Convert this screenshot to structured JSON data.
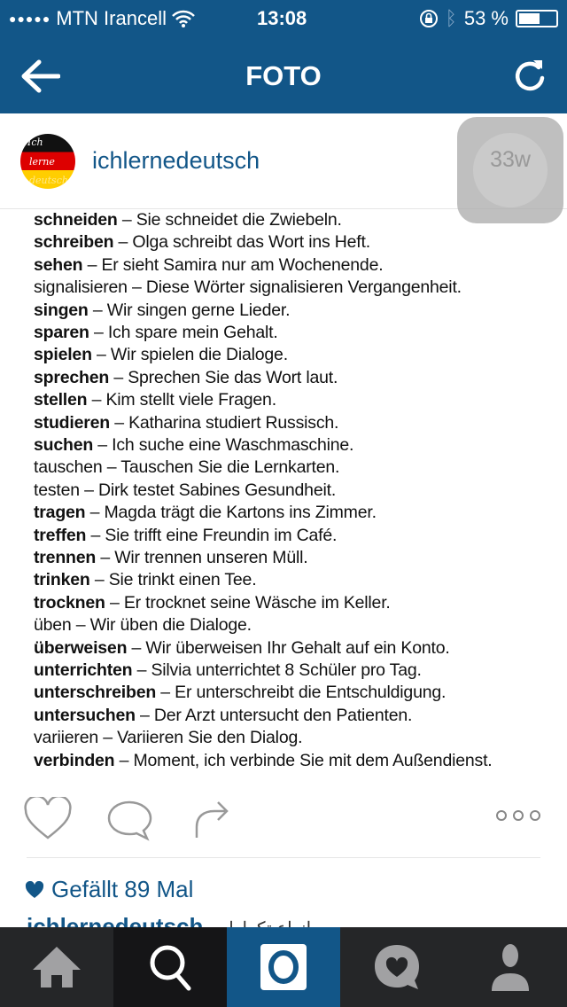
{
  "status": {
    "carrier": "MTN Irancell",
    "time": "13:08",
    "battery": "53 %",
    "battery_level": 53
  },
  "nav": {
    "title": "FOTO"
  },
  "post": {
    "username": "ichlernedeutsch",
    "avatar_text": [
      "Ich",
      "lerne",
      "deutsch"
    ],
    "timer": "33w",
    "photo_lines": [
      {
        "verb": "schneiden",
        "bold": true,
        "sentence": " – Sie schneidet die Zwiebeln."
      },
      {
        "verb": "schreiben",
        "bold": true,
        "sentence": " – Olga schreibt das Wort ins Heft."
      },
      {
        "verb": "sehen",
        "bold": true,
        "sentence": " – Er sieht Samira nur am Wochenende."
      },
      {
        "verb": "signalisieren",
        "bold": false,
        "sentence": " – Diese Wörter signalisieren Vergangenheit."
      },
      {
        "verb": "singen",
        "bold": true,
        "sentence": " – Wir singen gerne Lieder."
      },
      {
        "verb": "sparen",
        "bold": true,
        "sentence": " – Ich spare mein Gehalt."
      },
      {
        "verb": "spielen",
        "bold": true,
        "sentence": " – Wir spielen die Dialoge."
      },
      {
        "verb": "sprechen",
        "bold": true,
        "sentence": " – Sprechen Sie das Wort laut."
      },
      {
        "verb": "stellen",
        "bold": true,
        "sentence": " – Kim stellt viele Fragen."
      },
      {
        "verb": "studieren",
        "bold": true,
        "sentence": " – Katharina studiert Russisch."
      },
      {
        "verb": "suchen",
        "bold": true,
        "sentence": " – Ich suche eine Waschmaschine."
      },
      {
        "verb": "tauschen",
        "bold": false,
        "sentence": " – Tauschen Sie die Lernkarten."
      },
      {
        "verb": "testen",
        "bold": false,
        "sentence": " – Dirk testet Sabines Gesundheit."
      },
      {
        "verb": "tragen",
        "bold": true,
        "sentence": " – Magda trägt die Kartons ins Zimmer."
      },
      {
        "verb": "treffen",
        "bold": true,
        "sentence": " – Sie trifft eine Freundin im Café."
      },
      {
        "verb": "trennen",
        "bold": true,
        "sentence": " – Wir trennen unseren Müll."
      },
      {
        "verb": "trinken",
        "bold": true,
        "sentence": " – Sie trinkt einen Tee."
      },
      {
        "verb": "trocknen",
        "bold": true,
        "sentence": " – Er trocknet seine Wäsche im Keller."
      },
      {
        "verb": "üben",
        "bold": false,
        "sentence": " – Wir üben die Dialoge."
      },
      {
        "verb": "überweisen",
        "bold": true,
        "sentence": " – Wir überweisen Ihr Gehalt auf ein Konto."
      },
      {
        "verb": "unterrichten",
        "bold": true,
        "sentence": " – Silvia unterrichtet 8 Schüler pro Tag."
      },
      {
        "verb": "unterschreiben",
        "bold": true,
        "sentence": " – Er unterschreibt die Entschuldigung."
      },
      {
        "verb": "untersuchen",
        "bold": true,
        "sentence": " – Der Arzt untersucht den Patienten."
      },
      {
        "verb": "variieren",
        "bold": false,
        "sentence": " – Variieren Sie den Dialog."
      },
      {
        "verb": "verbinden",
        "bold": true,
        "sentence": " – Moment, ich verbinde Sie mit dem Außendienst."
      }
    ],
    "likes": "Gefällt 89 Mal",
    "caption_user": "ichlernedeutsch",
    "caption_text": "انواع تكرارات"
  },
  "tabs": [
    {
      "icon": "home-icon"
    },
    {
      "icon": "search-icon",
      "active": true
    },
    {
      "icon": "camera-icon",
      "highlight": true
    },
    {
      "icon": "activity-icon"
    },
    {
      "icon": "profile-icon"
    }
  ],
  "colors": {
    "brand": "#125688",
    "tabbar": "#252628",
    "tab_active": "#151517"
  }
}
